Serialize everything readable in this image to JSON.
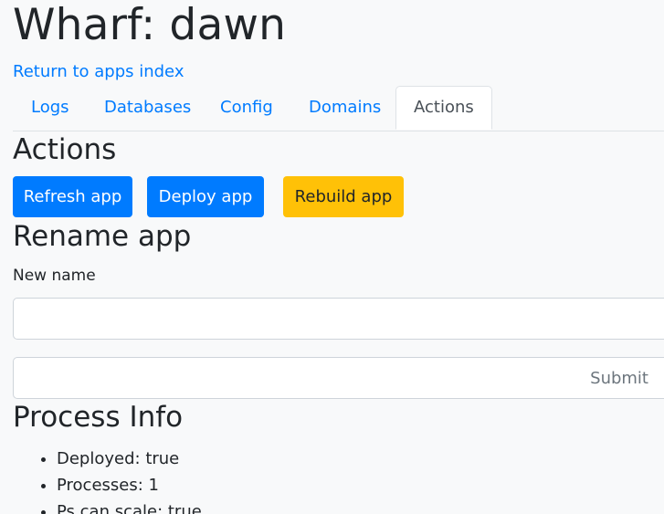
{
  "header": {
    "title": "Wharf: dawn",
    "back_link": "Return to apps index"
  },
  "tabs": [
    {
      "label": "Logs",
      "active": false
    },
    {
      "label": "Databases",
      "active": false
    },
    {
      "label": "Config",
      "active": false
    },
    {
      "label": "Domains",
      "active": false
    },
    {
      "label": "Actions",
      "active": true
    }
  ],
  "actions": {
    "title": "Actions",
    "refresh_label": "Refresh app",
    "deploy_label": "Deploy app",
    "rebuild_label": "Rebuild app"
  },
  "rename": {
    "title": "Rename app",
    "field_label": "New name",
    "field_value": "",
    "submit_label": "Submit"
  },
  "process_info": {
    "title": "Process Info",
    "items": [
      {
        "label": "Deployed: true"
      },
      {
        "label": "Processes: 1"
      },
      {
        "label": "Ps can scale: true"
      }
    ]
  },
  "colors": {
    "primary": "#007bff",
    "warning": "#ffc107",
    "background": "#f8f9fa",
    "text": "#212529"
  }
}
